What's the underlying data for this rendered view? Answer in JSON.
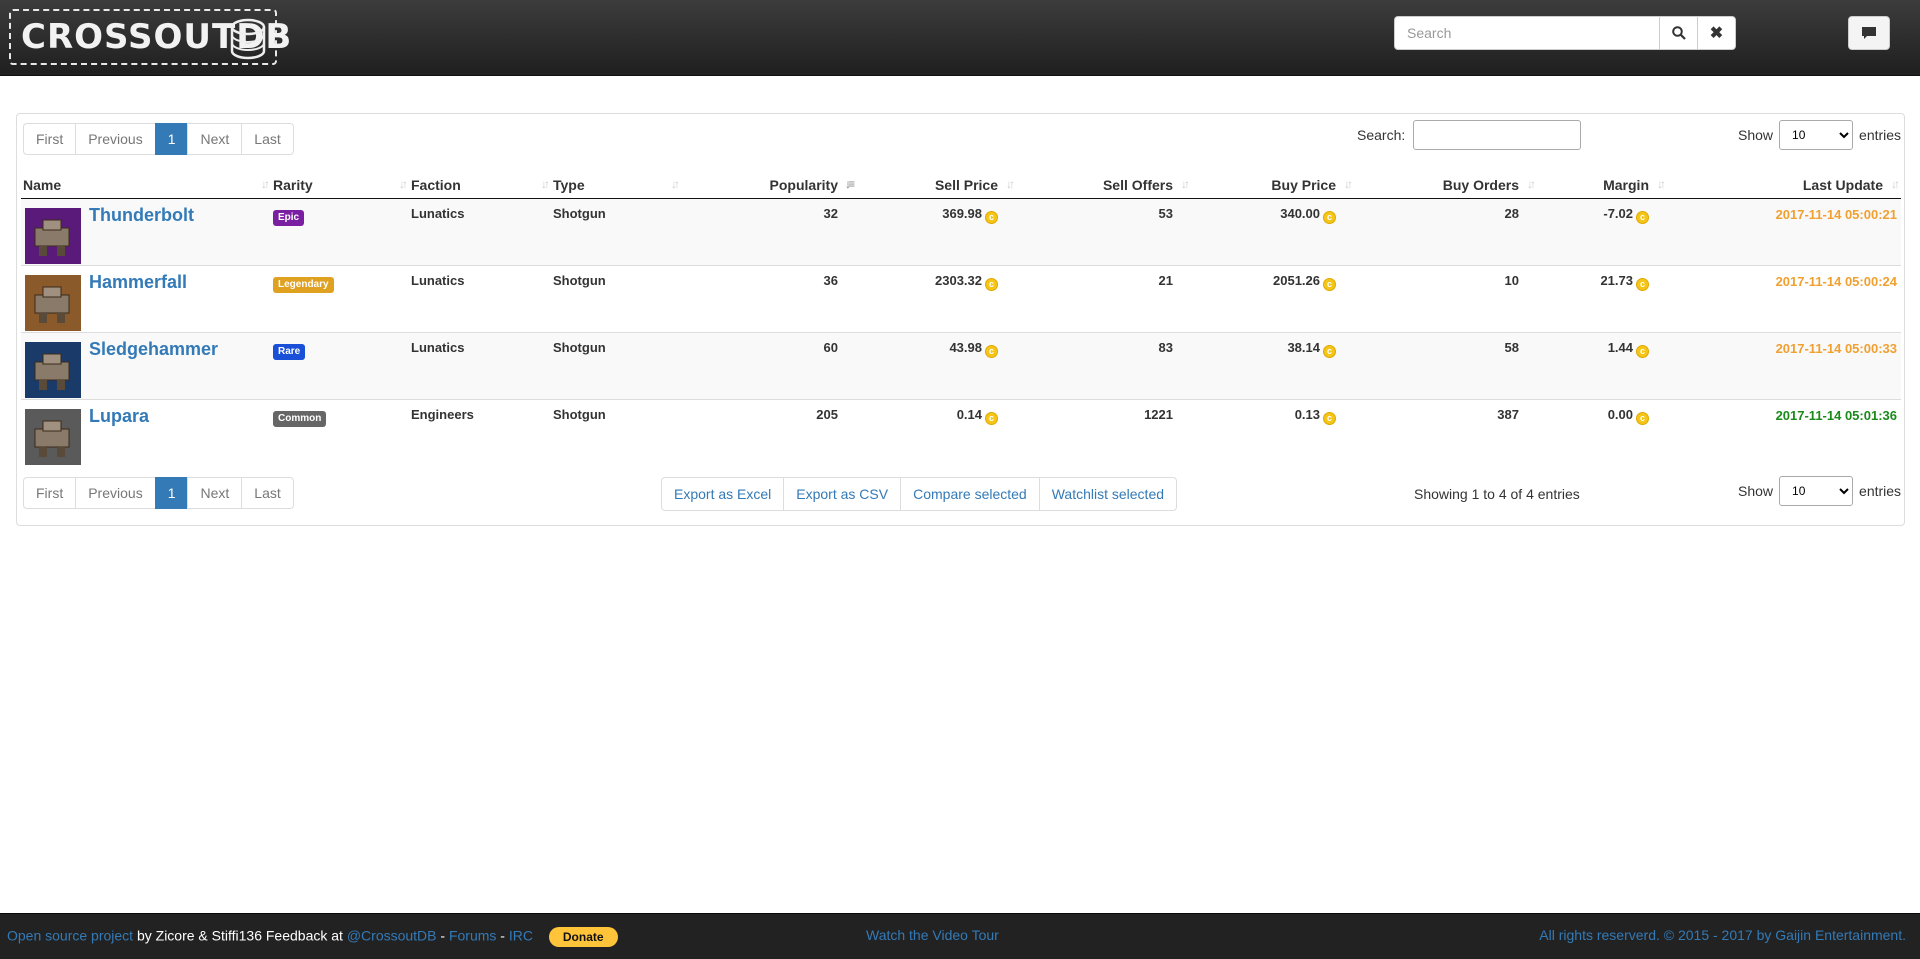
{
  "header": {
    "logo_text": "CROSSOUTDB",
    "search_placeholder": "Search",
    "search_button_icon": "search-icon",
    "clear_button_icon": "close-icon",
    "chat_button_icon": "comment-icon"
  },
  "pagination": {
    "first": "First",
    "previous": "Previous",
    "current": "1",
    "next": "Next",
    "last": "Last"
  },
  "table_search": {
    "label": "Search:",
    "value": ""
  },
  "length": {
    "show": "Show",
    "value": "10",
    "entries": "entries"
  },
  "columns": {
    "name": "Name",
    "rarity": "Rarity",
    "faction": "Faction",
    "type": "Type",
    "popularity": "Popularity",
    "sell_price": "Sell Price",
    "sell_offers": "Sell Offers",
    "buy_price": "Buy Price",
    "buy_orders": "Buy Orders",
    "margin": "Margin",
    "last_update": "Last Update"
  },
  "rows": [
    {
      "name": "Thunderbolt",
      "rarity": "Epic",
      "rarity_color": "#7b1fa2",
      "faction": "Lunatics",
      "type": "Shotgun",
      "popularity": "32",
      "sell_price": "369.98",
      "sell_offers": "53",
      "buy_price": "340.00",
      "buy_orders": "28",
      "margin": "-7.02",
      "last_update": "2017-11-14 05:00:21",
      "date_color": "#f0a030",
      "thumb_bg": "#5a1a7a"
    },
    {
      "name": "Hammerfall",
      "rarity": "Legendary",
      "rarity_color": "#e0a020",
      "faction": "Lunatics",
      "type": "Shotgun",
      "popularity": "36",
      "sell_price": "2303.32",
      "sell_offers": "21",
      "buy_price": "2051.26",
      "buy_orders": "10",
      "margin": "21.73",
      "last_update": "2017-11-14 05:00:24",
      "date_color": "#f0a030",
      "thumb_bg": "#8a5a2a"
    },
    {
      "name": "Sledgehammer",
      "rarity": "Rare",
      "rarity_color": "#1a4fd8",
      "faction": "Lunatics",
      "type": "Shotgun",
      "popularity": "60",
      "sell_price": "43.98",
      "sell_offers": "83",
      "buy_price": "38.14",
      "buy_orders": "58",
      "margin": "1.44",
      "last_update": "2017-11-14 05:00:33",
      "date_color": "#f0a030",
      "thumb_bg": "#1a3a6a"
    },
    {
      "name": "Lupara",
      "rarity": "Common",
      "rarity_color": "#666666",
      "faction": "Engineers",
      "type": "Shotgun",
      "popularity": "205",
      "sell_price": "0.14",
      "sell_offers": "1221",
      "buy_price": "0.13",
      "buy_orders": "387",
      "margin": "0.00",
      "last_update": "2017-11-14 05:01:36",
      "date_color": "#1a8a1a",
      "thumb_bg": "#5a5a5a"
    }
  ],
  "actions": {
    "export_excel": "Export as Excel",
    "export_csv": "Export as CSV",
    "compare": "Compare selected",
    "watchlist": "Watchlist selected"
  },
  "info": "Showing 1 to 4 of 4 entries",
  "footer": {
    "open_source": "Open source project",
    "by": " by Zicore & Stiffi136 Feedback at ",
    "twitter": "@CrossoutDB",
    "sep1": " - ",
    "forums": "Forums",
    "sep2": " - ",
    "irc": "IRC",
    "donate": "Donate",
    "video_tour": "Watch the Video Tour",
    "rights": "All rights reserverd. © 2015 - 2017 by Gaijin Entertainment."
  },
  "colors": {
    "accent": "#337ab7",
    "navbar": "#2b2b2b",
    "coin": "#f5c518"
  }
}
